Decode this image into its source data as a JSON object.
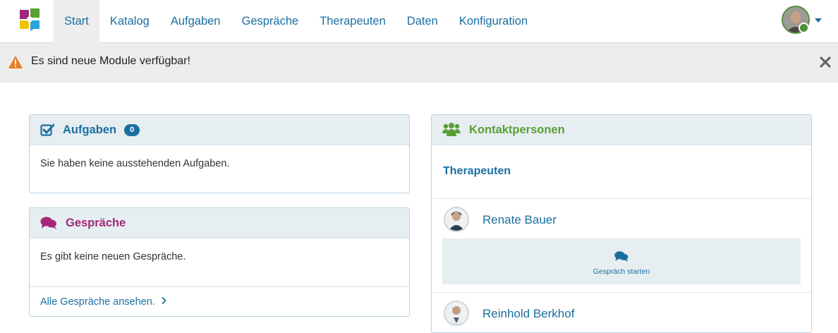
{
  "nav": {
    "items": [
      "Start",
      "Katalog",
      "Aufgaben",
      "Gespräche",
      "Therapeuten",
      "Daten",
      "Konfiguration"
    ],
    "active_index": 0
  },
  "alert": {
    "text": "Es sind neue Module verfügbar!"
  },
  "tasks": {
    "title": "Aufgaben",
    "count": "0",
    "empty_text": "Sie haben keine ausstehenden Aufgaben."
  },
  "conversations": {
    "title": "Gespräche",
    "empty_text": "Es gibt keine neuen Gespräche.",
    "view_all_link": "Alle Gespräche ansehen."
  },
  "contacts": {
    "title": "Kontaktpersonen",
    "section_heading": "Therapeuten",
    "people": [
      {
        "name": "Renate Bauer",
        "action_label": "Gespräch starten"
      },
      {
        "name": "Reinhold Berkhof"
      }
    ]
  },
  "colors": {
    "link": "#1b6fa0",
    "tasks_accent": "#1b6fa0",
    "conversations_accent": "#a3287c",
    "contacts_accent": "#5a9f32",
    "warning": "#e67e22"
  }
}
